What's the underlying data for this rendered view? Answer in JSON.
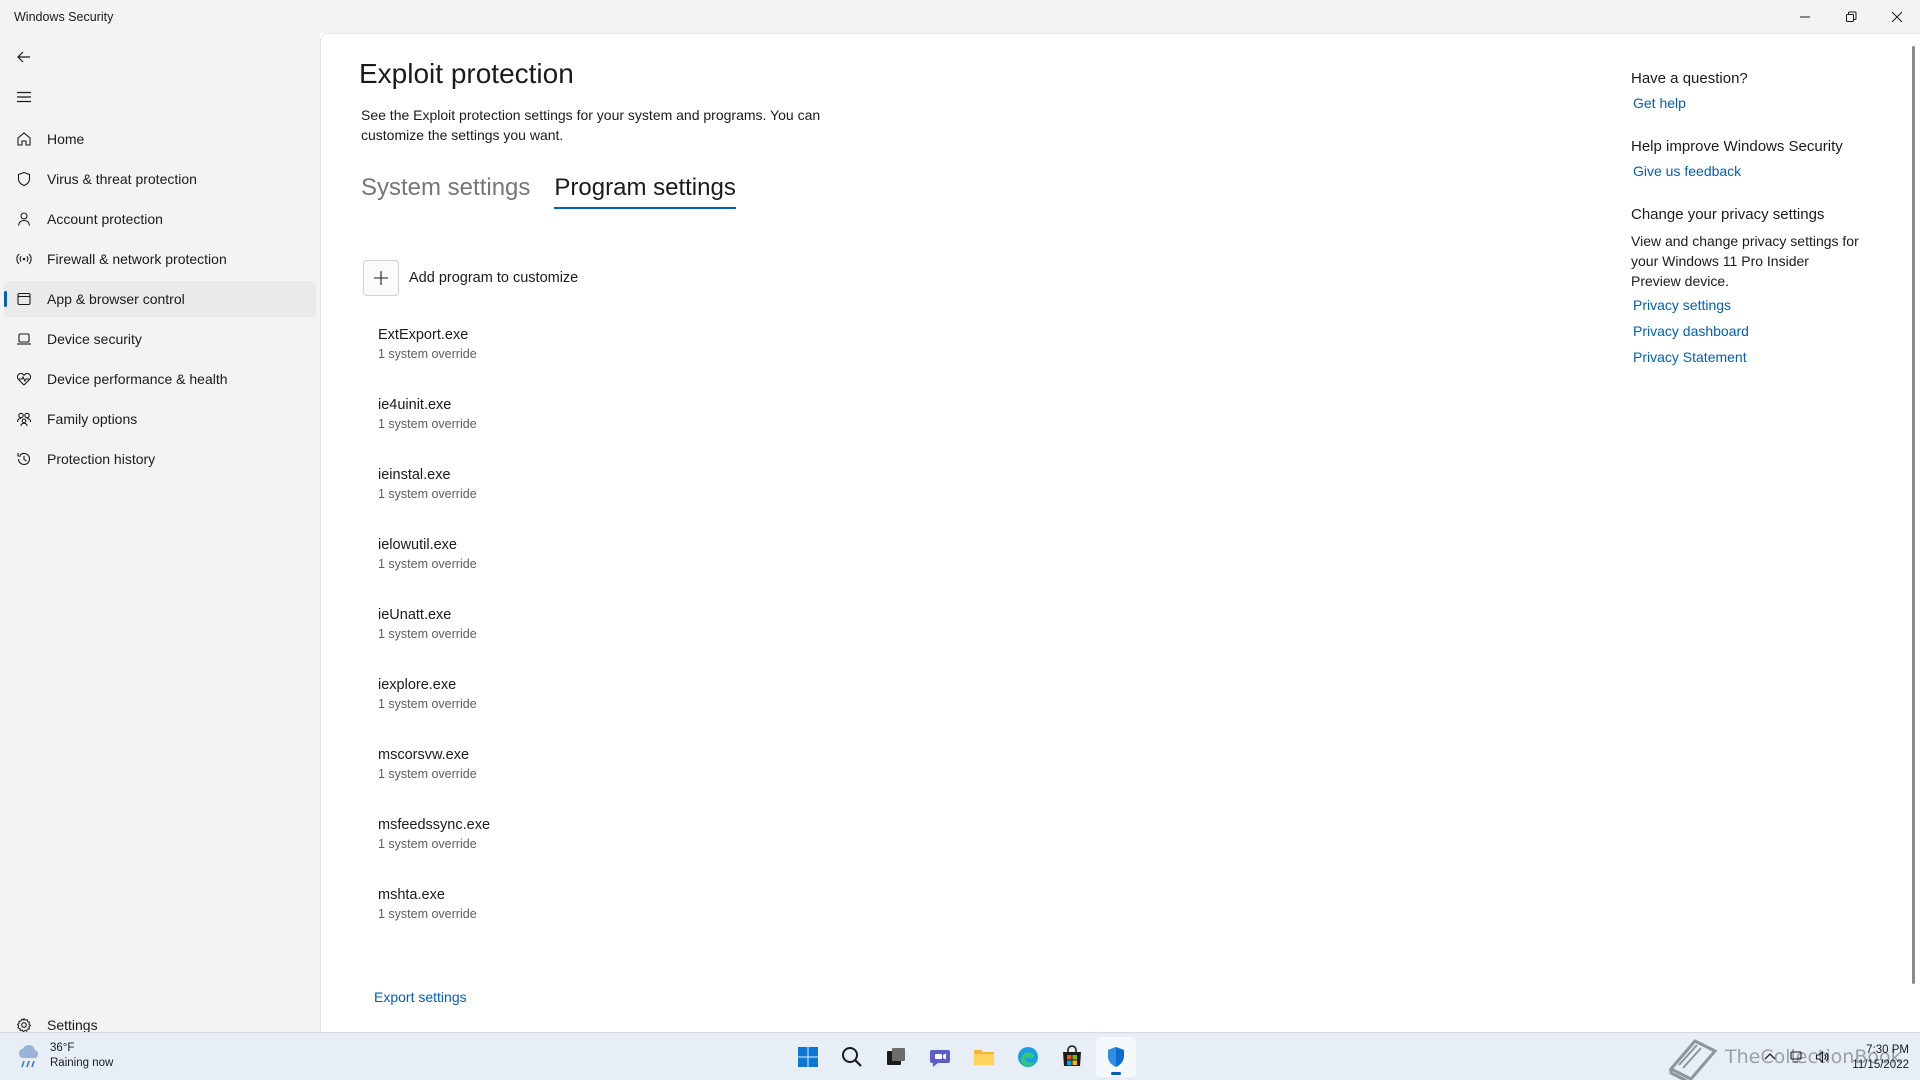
{
  "window": {
    "title": "Windows Security"
  },
  "sidebar": {
    "items": [
      {
        "label": "Home",
        "icon": "home-icon"
      },
      {
        "label": "Virus & threat protection",
        "icon": "shield-icon"
      },
      {
        "label": "Account protection",
        "icon": "person-icon"
      },
      {
        "label": "Firewall & network protection",
        "icon": "wireless-icon"
      },
      {
        "label": "App & browser control",
        "icon": "app-window-icon",
        "active": true
      },
      {
        "label": "Device security",
        "icon": "laptop-icon"
      },
      {
        "label": "Device performance & health",
        "icon": "heart-pulse-icon"
      },
      {
        "label": "Family options",
        "icon": "family-icon"
      },
      {
        "label": "Protection history",
        "icon": "history-icon"
      }
    ],
    "settings_label": "Settings"
  },
  "main": {
    "title": "Exploit protection",
    "description": "See the Exploit protection settings for your system and programs.  You can customize the settings you want.",
    "tabs": [
      {
        "label": "System settings",
        "active": false
      },
      {
        "label": "Program settings",
        "active": true
      }
    ],
    "add_program_label": "Add program to customize",
    "programs": [
      {
        "name": "ExtExport.exe",
        "detail": "1 system override"
      },
      {
        "name": "ie4uinit.exe",
        "detail": "1 system override"
      },
      {
        "name": "ieinstal.exe",
        "detail": "1 system override"
      },
      {
        "name": "ielowutil.exe",
        "detail": "1 system override"
      },
      {
        "name": "ieUnatt.exe",
        "detail": "1 system override"
      },
      {
        "name": "iexplore.exe",
        "detail": "1 system override"
      },
      {
        "name": "mscorsvw.exe",
        "detail": "1 system override"
      },
      {
        "name": "msfeedssync.exe",
        "detail": "1 system override"
      },
      {
        "name": "mshta.exe",
        "detail": "1 system override"
      }
    ],
    "export_label": "Export settings"
  },
  "right_panel": {
    "question_heading": "Have a question?",
    "get_help": "Get help",
    "improve_heading": "Help improve Windows Security",
    "feedback": "Give us feedback",
    "privacy_heading": "Change your privacy settings",
    "privacy_text": "View and change privacy settings for your Windows 11 Pro Insider Preview device.",
    "privacy_settings": "Privacy settings",
    "privacy_dashboard": "Privacy dashboard",
    "privacy_statement": "Privacy Statement"
  },
  "taskbar": {
    "weather_temp": "36°F",
    "weather_desc": "Raining now",
    "apps": [
      "windows-start-icon",
      "search-icon",
      "task-view-icon",
      "chat-icon",
      "file-explorer-icon",
      "edge-icon",
      "store-icon",
      "windows-security-icon"
    ],
    "watermark": "TheCollectionBook",
    "time": "7:30 PM",
    "date": "11/15/2022"
  },
  "colors": {
    "accent": "#005fb8",
    "sidebar_bg": "#f3f3f3",
    "taskbar_bg": "#e8eef6"
  }
}
